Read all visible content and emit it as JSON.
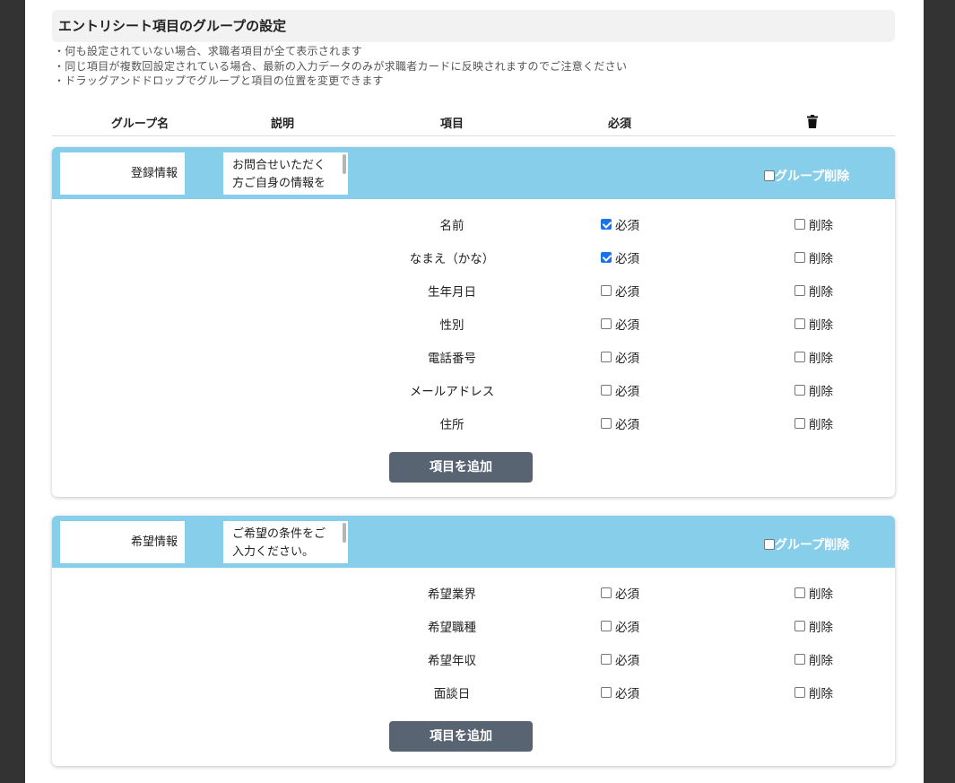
{
  "section": {
    "title": "エントリシート項目のグループの設定",
    "notes": [
      "・何も設定されていない場合、求職者項目が全て表示されます",
      "・同じ項目が複数回設定されている場合、最新の入力データのみが求職者カードに反映されますのでご注意ください",
      "・ドラッグアンドドロップでグループと項目の位置を変更できます"
    ]
  },
  "table_header": {
    "group_name": "グループ名",
    "description": "説明",
    "item": "項目",
    "required": "必須",
    "delete_icon": "trash-icon"
  },
  "groups": [
    {
      "name": "登録情報",
      "description_lines": [
        "お問合せいただく",
        "方ご自身の情報を"
      ],
      "group_delete_label": "グループ削除",
      "group_delete_checked": false,
      "add_item_label": "項目を追加",
      "items": [
        {
          "name": "名前",
          "required_label": "必須",
          "required": true,
          "delete_label": "削除",
          "delete": false
        },
        {
          "name": "なまえ（かな）",
          "required_label": "必須",
          "required": true,
          "delete_label": "削除",
          "delete": false
        },
        {
          "name": "生年月日",
          "required_label": "必須",
          "required": false,
          "delete_label": "削除",
          "delete": false
        },
        {
          "name": "性別",
          "required_label": "必須",
          "required": false,
          "delete_label": "削除",
          "delete": false
        },
        {
          "name": "電話番号",
          "required_label": "必須",
          "required": false,
          "delete_label": "削除",
          "delete": false
        },
        {
          "name": "メールアドレス",
          "required_label": "必須",
          "required": false,
          "delete_label": "削除",
          "delete": false
        },
        {
          "name": "住所",
          "required_label": "必須",
          "required": false,
          "delete_label": "削除",
          "delete": false
        }
      ]
    },
    {
      "name": "希望情報",
      "description_lines": [
        "ご希望の条件をご",
        "入力ください。"
      ],
      "group_delete_label": "グループ削除",
      "group_delete_checked": false,
      "add_item_label": "項目を追加",
      "items": [
        {
          "name": "希望業界",
          "required_label": "必須",
          "required": false,
          "delete_label": "削除",
          "delete": false
        },
        {
          "name": "希望職種",
          "required_label": "必須",
          "required": false,
          "delete_label": "削除",
          "delete": false
        },
        {
          "name": "希望年収",
          "required_label": "必須",
          "required": false,
          "delete_label": "削除",
          "delete": false
        },
        {
          "name": "面談日",
          "required_label": "必須",
          "required": false,
          "delete_label": "削除",
          "delete": false
        }
      ]
    }
  ],
  "colors": {
    "group_header_bg": "#87ceeb",
    "add_button_bg": "#596473",
    "checkbox_checked": "#1a73e8",
    "side_background": "#333333"
  }
}
